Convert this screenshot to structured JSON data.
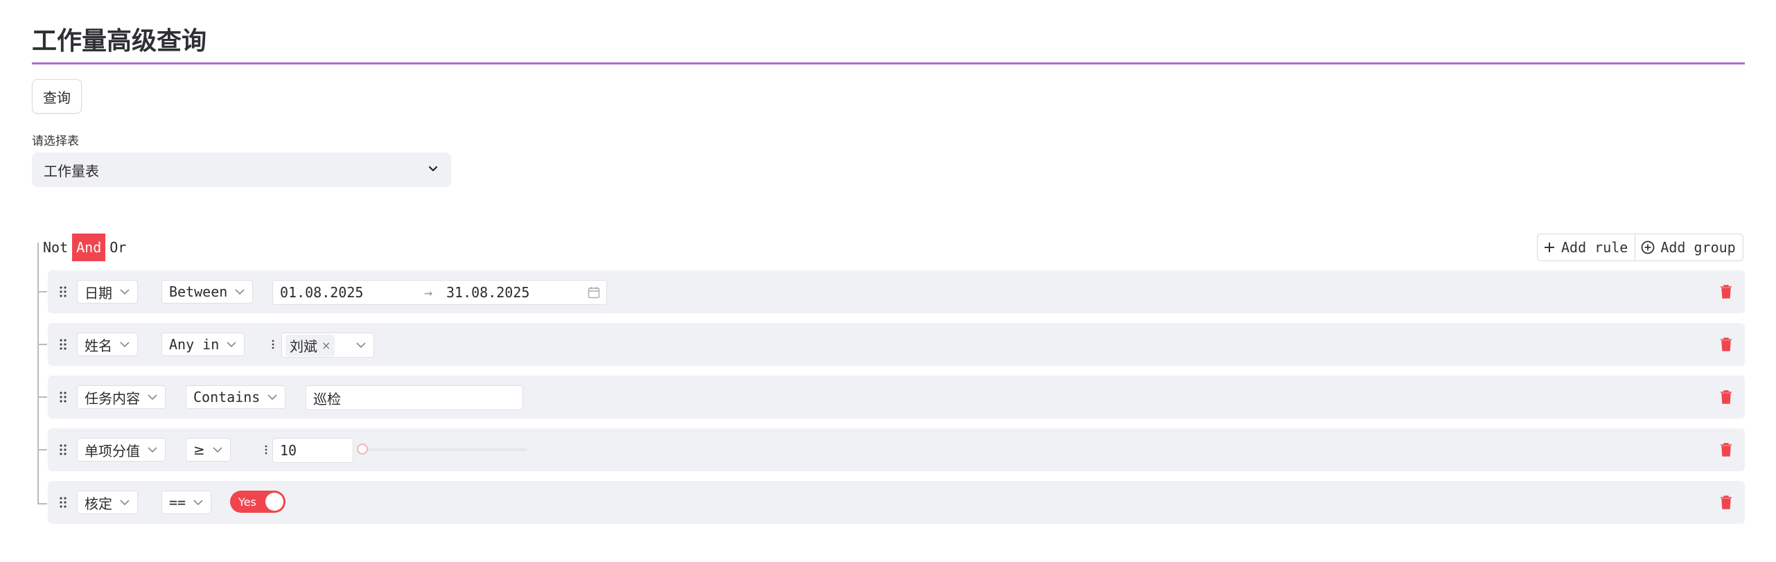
{
  "page": {
    "title": "工作量高级查询"
  },
  "toolbar": {
    "query_label": "查询"
  },
  "table_select": {
    "label": "请选择表",
    "value": "工作量表"
  },
  "combinators": {
    "not": "Not",
    "and": "And",
    "or": "Or",
    "active": "And"
  },
  "actions": {
    "add_rule": "Add rule",
    "add_group": "Add group"
  },
  "rules": [
    {
      "field": "日期",
      "operator": "Between",
      "value_start": "01.08.2025",
      "value_end": "31.08.2025",
      "range_separator": "→"
    },
    {
      "field": "姓名",
      "operator": "Any in",
      "tags": [
        "刘斌"
      ]
    },
    {
      "field": "任务内容",
      "operator": "Contains",
      "value": "巡检"
    },
    {
      "field": "单项分值",
      "operator": "≥",
      "value": "10",
      "slider_value": 10
    },
    {
      "field": "核定",
      "operator": "==",
      "toggle_label": "Yes",
      "toggle_on": true
    }
  ],
  "colors": {
    "accent": "#f0454f",
    "title_rule": "#b06ad6",
    "row_bg": "#f0f1f4"
  },
  "icons": {
    "drag": "drag-handle-icon",
    "chevron": "chevron-down-icon",
    "trash": "trash-icon",
    "calendar": "calendar-icon",
    "plus": "plus-icon",
    "plus_circle": "plus-circle-icon",
    "close": "close-icon"
  }
}
